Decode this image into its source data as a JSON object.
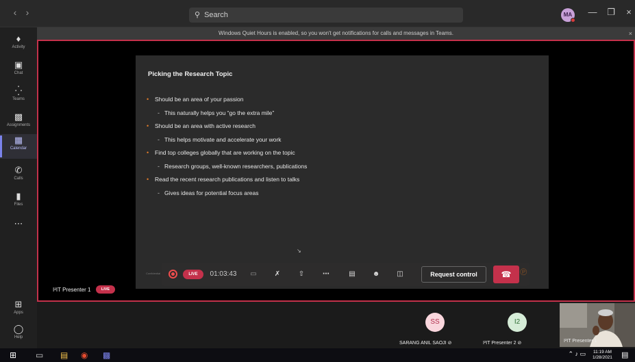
{
  "window": {
    "search_placeholder": "Search",
    "user_initials": "MA"
  },
  "notice": {
    "text": "Windows Quiet Hours is enabled, so you won't get notifications for calls and messages in Teams."
  },
  "rail": {
    "items": [
      {
        "label": "Activity",
        "icon": "bell-icon"
      },
      {
        "label": "Chat",
        "icon": "chat-icon"
      },
      {
        "label": "Teams",
        "icon": "teams-icon"
      },
      {
        "label": "Assignments",
        "icon": "assignments-icon"
      },
      {
        "label": "Calendar",
        "icon": "calendar-icon",
        "active": true
      },
      {
        "label": "Calls",
        "icon": "phone-icon"
      },
      {
        "label": "Files",
        "icon": "file-icon"
      },
      {
        "label": "Apps",
        "icon": "apps-icon"
      },
      {
        "label": "Help",
        "icon": "help-icon"
      }
    ]
  },
  "slide": {
    "title": "Picking the Research Topic",
    "bullets": [
      {
        "text": "Should be an area of your passion",
        "level": 1
      },
      {
        "text": "This naturally helps you “go the extra mile”",
        "level": 2
      },
      {
        "text": "Should be an area with active research",
        "level": 1
      },
      {
        "text": "This helps motivate and accelerate your work",
        "level": 2
      },
      {
        "text": "Find top colleges globally that are working on the topic",
        "level": 1
      },
      {
        "text": "Research groups, well-known researchers, publications",
        "level": 2
      },
      {
        "text": "Read the recent research publications and listen to talks",
        "level": 1
      },
      {
        "text": "Gives ideas for potential focus areas",
        "level": 2
      }
    ],
    "footer_left": "Confidential"
  },
  "meeting_toolbar": {
    "live_label": "LIVE",
    "timer": "01:03:43",
    "request_control_label": "Request control"
  },
  "presenter": {
    "name": "I²IT Presenter 1",
    "live_label": "LIVE"
  },
  "participants": [
    {
      "initials": "SS",
      "name": "SARANG ANIL SAOJI",
      "avatar_color": "#f9d6dd",
      "text_color": "#b02f4c"
    },
    {
      "initials": "I2",
      "name": "I²IT Presenter 2",
      "avatar_color": "#d5ecd7",
      "text_color": "#2f6e35"
    }
  ],
  "webcam": {
    "name": "I²IT Presenter 1"
  },
  "taskbar": {
    "time": "11:19 AM",
    "date": "1/28/2021"
  }
}
